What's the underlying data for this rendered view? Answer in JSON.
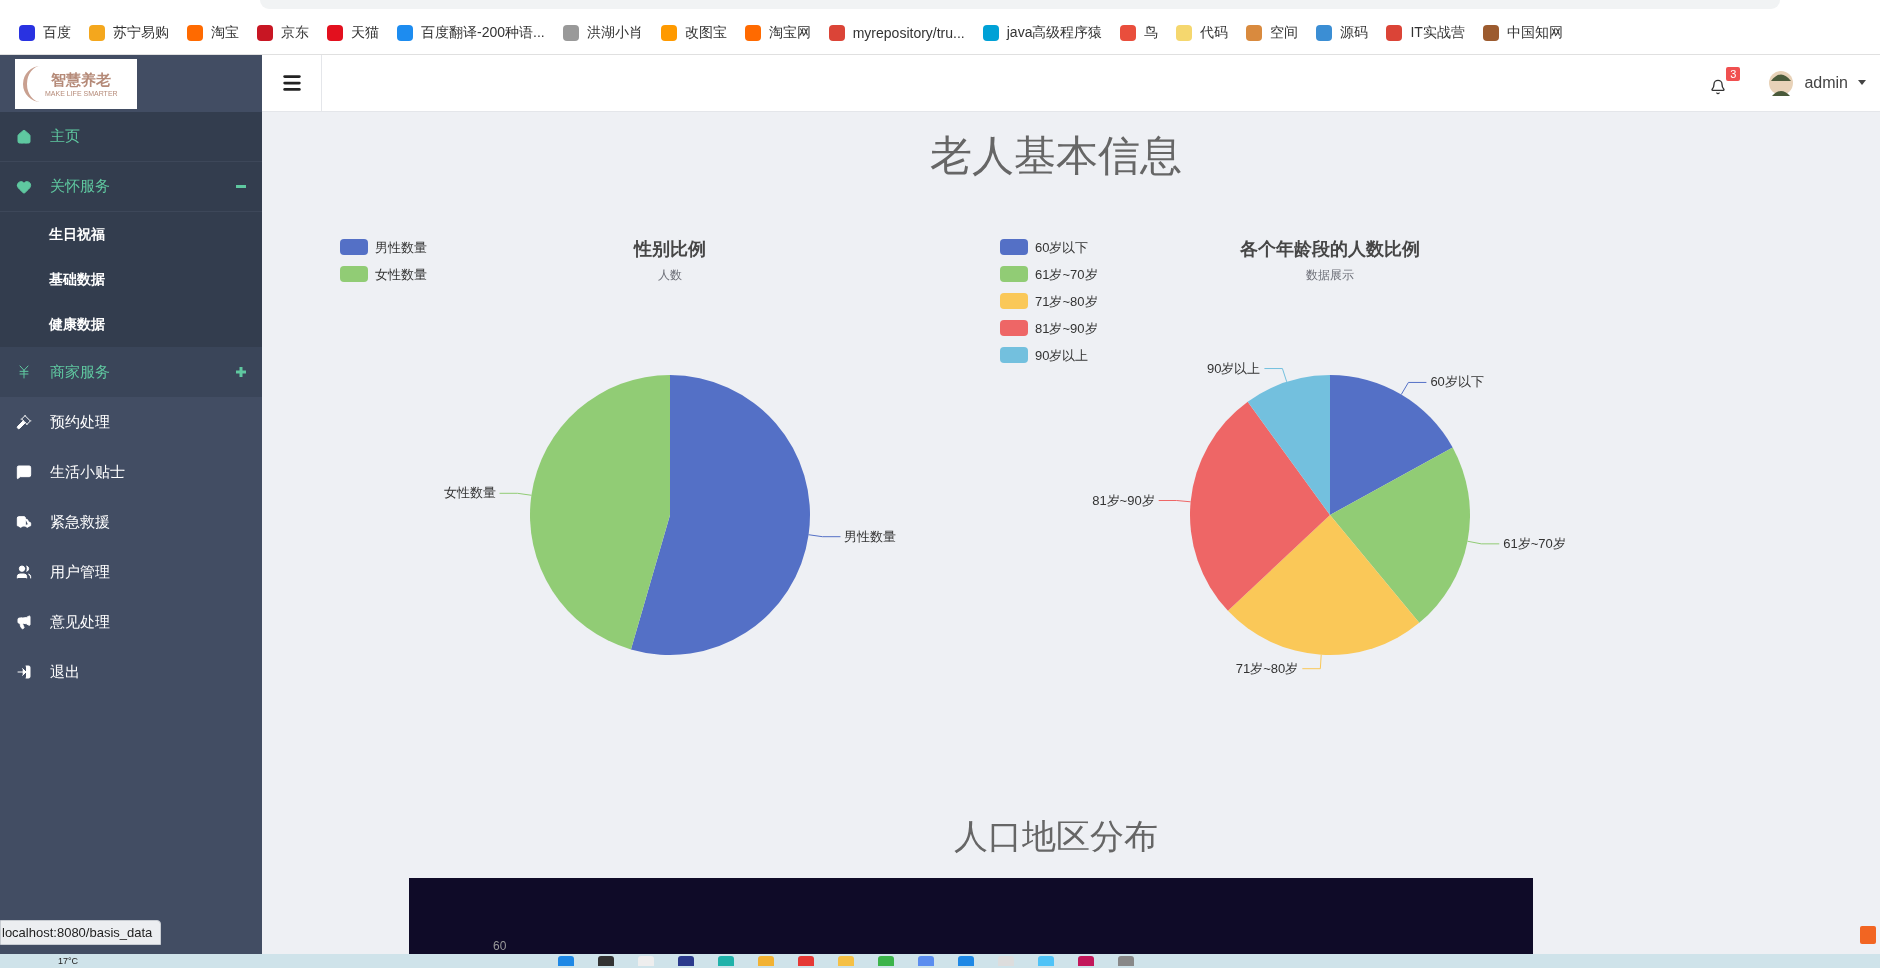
{
  "bookmarks": [
    {
      "label": "百度"
    },
    {
      "label": "苏宁易购"
    },
    {
      "label": "淘宝"
    },
    {
      "label": "京东"
    },
    {
      "label": "天猫"
    },
    {
      "label": "百度翻译-200种语..."
    },
    {
      "label": "洪湖小肖"
    },
    {
      "label": "改图宝"
    },
    {
      "label": "淘宝网"
    },
    {
      "label": "myrepository/tru..."
    },
    {
      "label": "java高级程序猿"
    },
    {
      "label": "鸟"
    },
    {
      "label": "代码"
    },
    {
      "label": "空间"
    },
    {
      "label": "源码"
    },
    {
      "label": "IT实战营"
    },
    {
      "label": "中国知网"
    }
  ],
  "sidebar": {
    "logo": {
      "title": "智慧养老",
      "tagline": "MAKE LIFE SMARTER"
    },
    "items": [
      {
        "kind": "link",
        "label": "主页",
        "selected": true
      },
      {
        "kind": "group",
        "label": "关怀服务",
        "expanded": true,
        "children": [
          {
            "label": "生日祝福",
            "selected": false
          },
          {
            "label": "基础数据",
            "selected": false
          },
          {
            "label": "健康数据",
            "selected": false
          }
        ]
      },
      {
        "kind": "group",
        "label": "商家服务",
        "expanded": false,
        "hovered": true
      },
      {
        "kind": "link",
        "label": "预约处理",
        "selected": false
      },
      {
        "kind": "link",
        "label": "生活小贴士",
        "selected": false
      },
      {
        "kind": "link",
        "label": "紧急救援",
        "selected": false
      },
      {
        "kind": "link",
        "label": "用户管理",
        "selected": false
      },
      {
        "kind": "link",
        "label": "意见处理",
        "selected": false
      },
      {
        "kind": "link",
        "label": "退出",
        "selected": false
      }
    ]
  },
  "header": {
    "notifications": "3",
    "user": "admin"
  },
  "page_title": "老人基本信息",
  "charts": [
    {
      "subtitle": "人数",
      "legend": [
        {
          "label": "男性数量",
          "color": "#5470c6"
        },
        {
          "label": "女性数量",
          "color": "#91cc75"
        }
      ],
      "chart_data": {
        "type": "pie",
        "title": "性别比例",
        "categories": [
          "男性数量",
          "女性数量"
        ],
        "values": [
          54.5,
          45.5
        ]
      }
    },
    {
      "subtitle": "数据展示",
      "legend": [
        {
          "label": "60岁以下",
          "color": "#5470c6"
        },
        {
          "label": "61岁~70岁",
          "color": "#91cc75"
        },
        {
          "label": "71岁~80岁",
          "color": "#fac858"
        },
        {
          "label": "81岁~90岁",
          "color": "#ee6666"
        },
        {
          "label": "90岁以上",
          "color": "#73c0de"
        }
      ],
      "chart_data": {
        "type": "pie",
        "title": "各个年龄段的人数比例",
        "categories": [
          "60岁以下",
          "61岁~70岁",
          "71岁~80岁",
          "81岁~90岁",
          "90岁以上"
        ],
        "values": [
          17,
          22,
          24,
          27,
          10
        ]
      }
    }
  ],
  "region_section": {
    "title": "人口地区分布",
    "axis_label": "60"
  },
  "status_bubble": "localhost:8080/basis_data",
  "taskbar": {
    "weather": "17°C"
  }
}
